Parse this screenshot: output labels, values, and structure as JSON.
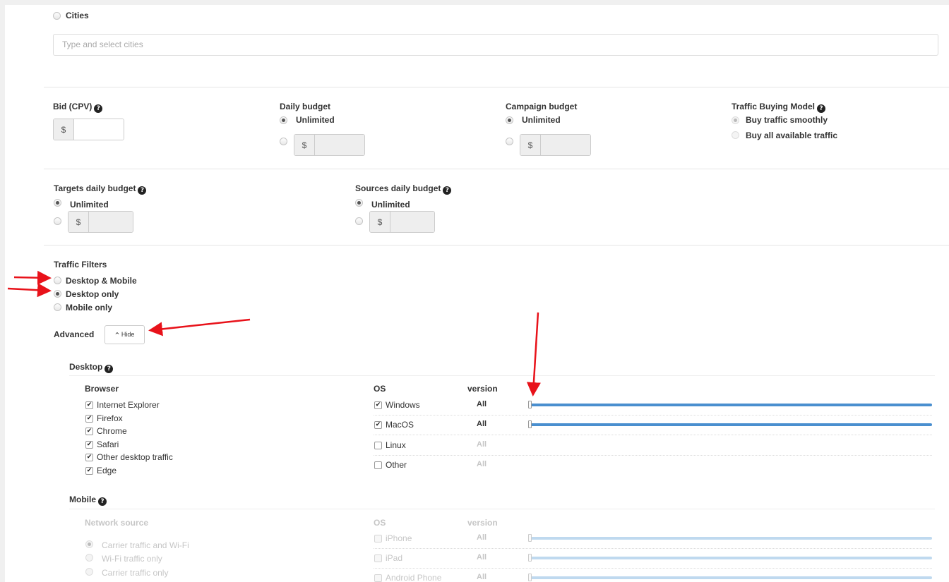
{
  "location": {
    "cities_label": "Cities",
    "cities_placeholder": "Type and select cities"
  },
  "bid": {
    "label": "Bid (CPV)",
    "currency": "$"
  },
  "daily_budget": {
    "label": "Daily budget",
    "unlimited": "Unlimited",
    "currency": "$"
  },
  "campaign_budget": {
    "label": "Campaign budget",
    "unlimited": "Unlimited",
    "currency": "$"
  },
  "traffic_model": {
    "label": "Traffic Buying Model",
    "options": [
      "Buy traffic smoothly",
      "Buy all available traffic"
    ]
  },
  "targets_budget": {
    "label": "Targets daily budget",
    "unlimited": "Unlimited",
    "currency": "$"
  },
  "sources_budget": {
    "label": "Sources daily budget",
    "unlimited": "Unlimited",
    "currency": "$"
  },
  "traffic_filters": {
    "label": "Traffic Filters",
    "options": [
      "Desktop & Mobile",
      "Desktop only",
      "Mobile only"
    ],
    "selected": "Desktop only"
  },
  "advanced": {
    "label": "Advanced",
    "hide_button": "Hide"
  },
  "desktop": {
    "title": "Desktop",
    "browser_header": "Browser",
    "browsers": [
      "Internet Explorer",
      "Firefox",
      "Chrome",
      "Safari",
      "Other desktop traffic",
      "Edge"
    ],
    "os_header": "OS",
    "version_header": "version",
    "os": [
      {
        "name": "Windows",
        "version": "All",
        "checked": true
      },
      {
        "name": "MacOS",
        "version": "All",
        "checked": true
      },
      {
        "name": "Linux",
        "version": "All",
        "checked": false
      },
      {
        "name": "Other",
        "version": "All",
        "checked": false
      }
    ]
  },
  "mobile": {
    "title": "Mobile",
    "network_header": "Network source",
    "network_options": [
      "Carrier traffic and Wi-Fi",
      "Wi-Fi traffic only",
      "Carrier traffic only"
    ],
    "os_header": "OS",
    "version_header": "version",
    "os": [
      {
        "name": "iPhone",
        "version": "All"
      },
      {
        "name": "iPad",
        "version": "All"
      },
      {
        "name": "Android Phone",
        "version": "All"
      }
    ]
  },
  "colors": {
    "annotation_arrow": "#e8121a",
    "slider": "#4a8fcf",
    "slider_disabled": "#bfd9ef"
  }
}
